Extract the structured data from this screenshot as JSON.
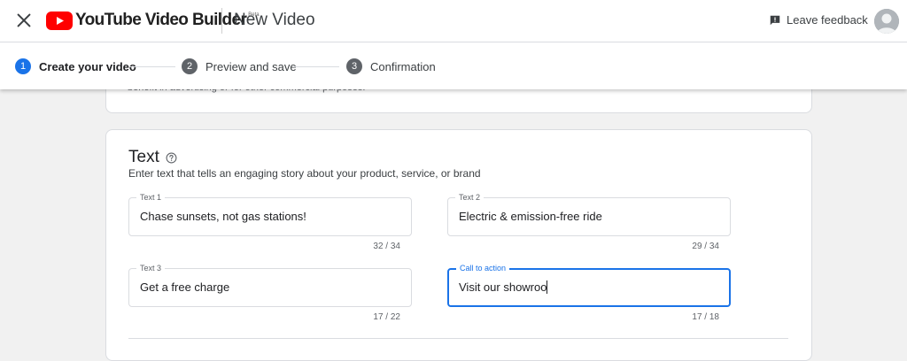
{
  "appbar": {
    "brand": "YouTube Video Builder",
    "beta": "Beta",
    "title": "New Video",
    "feedback_label": "Leave feedback",
    "icons": {
      "close": "close-icon",
      "logo": "youtube-logo-icon",
      "feedback": "feedback-icon",
      "avatar": "account-avatar-icon"
    }
  },
  "stepper": {
    "steps": [
      {
        "num": "1",
        "label": "Create your video",
        "state": "active"
      },
      {
        "num": "2",
        "label": "Preview and save",
        "state": "inactive"
      },
      {
        "num": "3",
        "label": "Confirmation",
        "state": "inactive"
      }
    ]
  },
  "previous_card": {
    "partial_text": "benefit in advertising or for other commercial purposes."
  },
  "text_card": {
    "title": "Text",
    "description": "Enter text that tells an engaging story about your product, service, or brand",
    "fields": [
      {
        "label": "Text 1",
        "value": "Chase sunsets, not gas stations!",
        "counter": "32 / 34",
        "focused": false
      },
      {
        "label": "Text 2",
        "value": "Electric & emission-free ride",
        "counter": "29 / 34",
        "focused": false
      },
      {
        "label": "Text 3",
        "value": "Get a free charge",
        "counter": "17 / 22",
        "focused": false
      },
      {
        "label": "Call to action",
        "value": "Visit our showroo",
        "counter": "17 / 18",
        "focused": true
      }
    ]
  },
  "colors": {
    "accent": "#1a73e8",
    "youtube_red": "#ff0000",
    "step_inactive": "#5f6368"
  }
}
